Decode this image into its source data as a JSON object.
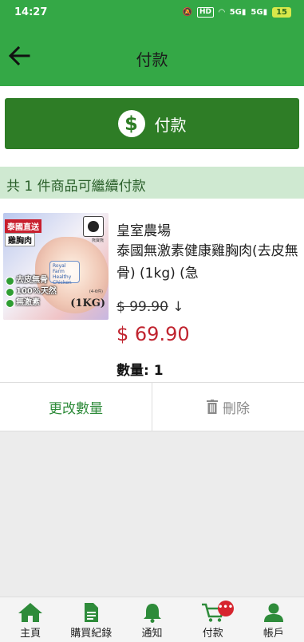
{
  "status_bar": {
    "time": "14:27",
    "hd": "HD",
    "net1": "5G",
    "net2": "5G",
    "battery": "15"
  },
  "header": {
    "title": "付款"
  },
  "pay_button": {
    "label": "付款",
    "icon": "dollar-icon"
  },
  "banner": {
    "text": "共 1 件商品可繼續付款"
  },
  "item": {
    "image_text": {
      "tag1": "泰國直送",
      "tag2": "雞胸肉",
      "check1": "去皮無骨",
      "check2": "100%天然",
      "check3": "無激素",
      "weight": "(1KG)",
      "farm": "Royal Farm Healthy Chicken",
      "bear_label": "熊寶熊",
      "sub": "(4-6件)"
    },
    "brand": "皇室農場",
    "name": "泰國無激素健康雞胸肉(去皮無骨) (1kg) (急",
    "original_price": "$ 99.90",
    "arrow": "↓",
    "price": "$ 69.90",
    "quantity_label": "數量: 1"
  },
  "actions": {
    "edit_label": "更改數量",
    "delete_label": "刪除"
  },
  "tabs": [
    {
      "label": "主頁",
      "icon": "home-icon"
    },
    {
      "label": "購買紀錄",
      "icon": "document-icon"
    },
    {
      "label": "通知",
      "icon": "bell-icon"
    },
    {
      "label": "付款",
      "icon": "cart-icon",
      "badge": "•••"
    },
    {
      "label": "帳戶",
      "icon": "user-icon"
    }
  ],
  "colors": {
    "primary": "#34a846",
    "dark": "#2e7d26",
    "price": "#c0242f",
    "banner": "#cfe9d1"
  }
}
